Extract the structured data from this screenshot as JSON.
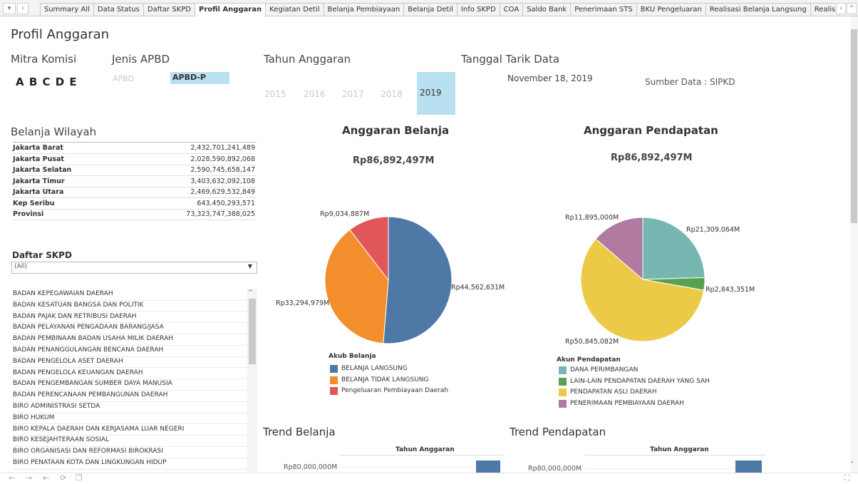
{
  "tabbar": {
    "tabs": [
      "Summary All",
      "Data Status",
      "Daftar SKPD",
      "Profil Anggaran",
      "Kegiatan Detil",
      "Belanja Pembiayaan",
      "Belanja Detil",
      "Info SKPD",
      "COA",
      "Saldo Bank",
      "Penerimaan STS",
      "BKU Pengeluaran",
      "Realisasi Belanja Langsung",
      "Realis"
    ],
    "active_index": 3
  },
  "page_title": "Profil Anggaran",
  "filters": {
    "mitra_label": "Mitra Komisi",
    "mitra_value": "A B C D E",
    "jenis_label": "Jenis APBD",
    "jenis_options": [
      "APBD",
      "APBD-P"
    ],
    "jenis_selected": "APBD-P",
    "tahun_label": "Tahun Anggaran",
    "tahun_options": [
      "2015",
      "2016",
      "2017",
      "2018",
      "2019"
    ],
    "tahun_selected": "2019",
    "tanggal_label": "Tanggal Tarik Data",
    "tanggal_value": "November 18, 2019",
    "sumber": "Sumber Data : SIPKD"
  },
  "belanja_wilayah": {
    "title": "Belanja Wilayah",
    "rows": [
      {
        "name": "Jakarta Barat",
        "value": "2,432,701,241,489"
      },
      {
        "name": "Jakarta Pusat",
        "value": "2,028,590,892,068"
      },
      {
        "name": "Jakarta Selatan",
        "value": "2,590,745,658,147"
      },
      {
        "name": "Jakarta Timur",
        "value": "3,403,632,092,108"
      },
      {
        "name": "Jakarta Utara",
        "value": "2,469,629,532,849"
      },
      {
        "name": "Kep Seribu",
        "value": "643,450,293,571"
      },
      {
        "name": "Provinsi",
        "value": "73,323,747,388,025"
      }
    ]
  },
  "daftar_skpd": {
    "title": "Daftar SKPD",
    "dropdown_value": "(All)",
    "items": [
      "BADAN KEPEGAWAIAN DAERAH",
      "BADAN KESATUAN BANGSA DAN POLITIK",
      "BADAN PAJAK DAN RETRIBUSI DAERAH",
      "BADAN PELAYANAN PENGADAAN BARANG/JASA",
      "BADAN PEMBINAAN BADAN USAHA MILIK DAERAH",
      "BADAN PENANGGULANGAN BENCANA DAERAH",
      "BADAN PENGELOLA ASET DAERAH",
      "BADAN PENGELOLA KEUANGAN DAERAH",
      "BADAN PENGEMBANGAN SUMBER DAYA MANUSIA",
      "BADAN PERENCANAAN PEMBANGUNAN DAERAH",
      "BIRO ADMINISTRASI SETDA",
      "BIRO HUKUM",
      "BIRO KEPALA DAERAH DAN KERJASAMA LUAR NEGERI",
      "BIRO KESEJAHTERAAN SOSIAL",
      "BIRO ORGANISASI DAN REFORMASI BIROKRASI",
      "BIRO PENATAAN KOTA DAN LINGKUNGAN HIDUP"
    ]
  },
  "chart_data": [
    {
      "type": "pie",
      "title": "Anggaran Belanja",
      "total_label": "Rp86,892,497M",
      "legend_title": "Akub Belanja",
      "slices": [
        {
          "name": "BELANJA LANGSUNG",
          "value": 44562631,
          "label": "Rp44,562,631M",
          "color": "#4e79a7"
        },
        {
          "name": "BELANJA TIDAK LANGSUNG",
          "value": 33294979,
          "label": "Rp33,294,979M",
          "color": "#f28e2b"
        },
        {
          "name": "Pengeluaran Pembiayaan Daerah",
          "value": 9034887,
          "label": "Rp9,034,887M",
          "color": "#e15759"
        }
      ]
    },
    {
      "type": "pie",
      "title": "Anggaran Pendapatan",
      "total_label": "Rp86,892,497M",
      "legend_title": "Akun Pendapatan",
      "slices": [
        {
          "name": "DANA PERIMBANGAN",
          "value": 21309064,
          "label": "Rp21,309,064M",
          "color": "#76b7b2"
        },
        {
          "name": "LAIN-LAIN PENDAPATAN DAERAH YANG SAH",
          "value": 2843351,
          "label": "Rp2,843,351M",
          "color": "#59a14f"
        },
        {
          "name": "PENDAPATAN ASLI DAERAH",
          "value": 50845082,
          "label": "Rp50,845,082M",
          "color": "#edc948"
        },
        {
          "name": "PENERIMAAN PEMBIAYAAN DAERAH",
          "value": 11895000,
          "label": "Rp11,895,000M",
          "color": "#b07aa1"
        }
      ]
    },
    {
      "type": "bar",
      "title": "Trend Belanja",
      "subtitle": "Tahun Anggaran",
      "ytick": "Rp80,000,000M"
    },
    {
      "type": "bar",
      "title": "Trend Pendapatan",
      "subtitle": "Tahun Anggaran",
      "ytick": "Rp80,000,000M"
    }
  ],
  "colors": {
    "selected_bg": "#b9e0f0",
    "bar": "#4e79a7"
  }
}
